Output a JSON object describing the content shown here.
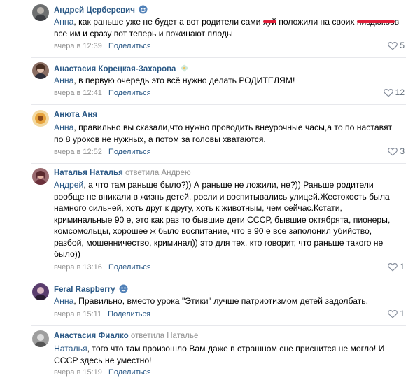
{
  "comments": [
    {
      "author": "Андрей Церберевич",
      "reply_to": "",
      "mention": "Анна",
      "text_before": ", как раньше уже не будет а вот родители сами ",
      "redacted_1": "хуй",
      "text_mid": " положили на своих ",
      "redacted_2": "пиздюков",
      "text_after": "в",
      "text_line2": "все им и сразу вот теперь и пожинают плоды",
      "date": "вчера в 12:39",
      "share": "Поделиться",
      "likes": "5"
    },
    {
      "author": "Анастасия Корецкая-Захарова",
      "reply_to": "",
      "mention": "Анна",
      "text": ", в первую очередь это всё нужно делать РОДИТЕЛЯМ!",
      "date": "вчера в 12:41",
      "share": "Поделиться",
      "likes": "12"
    },
    {
      "author": "Анюта Аня",
      "reply_to": "",
      "mention": "Анна",
      "text": ", правильно вы сказали,что нужно проводить внеурочные часы,а то по наставят",
      "text_line2": "по 8 уроков не нужных, а потом за головы хватаются.",
      "date": "вчера в 12:52",
      "share": "Поделиться",
      "likes": "3"
    },
    {
      "author": "Наталья Наталья",
      "reply_to": "ответила Андрею",
      "mention": "Андрей",
      "lines": [
        ", а что там раньше было?)) А раньше не ложили, не?)) Раньше родители",
        "вообще не вникали в жизнь детей, росли и воспитывались улицей.Жестокость была",
        "намного сильней, хоть друг к другу, хоть к животным, чем сейчас.Кстати,",
        "криминальные 90 е, это как раз то бывшие дети СССР, бывшие октябрята, пионеры,",
        "комсомольцы, хорошее ж было воспитание, что в 90 е все заполонил убийство,",
        "разбой, мошенничество, криминал)) это для тех, кто говорит, что раньше такого не",
        "было))"
      ],
      "date": "вчера в 13:16",
      "share": "Поделиться",
      "likes": "1"
    },
    {
      "author": "Feral Raspberry",
      "reply_to": "",
      "mention": "Анна",
      "text": ", Правильно, вместо урока \"Этики\" лучше патриотизмом детей задолбать.",
      "date": "вчера в 15:11",
      "share": "Поделиться",
      "likes": "1"
    },
    {
      "author": "Анастасия Фиалко",
      "reply_to": "ответила Наталье",
      "mention": "Наталья",
      "text": ", того что там произошло Вам даже в страшном сне приснится не могло! И",
      "text_line2": "СССР здесь не уместно!",
      "date": "вчера в 15:19",
      "share": "Поделиться",
      "likes": ""
    }
  ],
  "colors": {
    "link": "#2a5885",
    "meta": "#939393",
    "separator": "#e7e8ec",
    "redaction": "#e0203a",
    "verified_badge": "#5181b8"
  },
  "icons": {
    "like": "heart-outline-icon",
    "badge": "emoji-badge-icon",
    "badge_flower": "flower-badge-icon"
  }
}
